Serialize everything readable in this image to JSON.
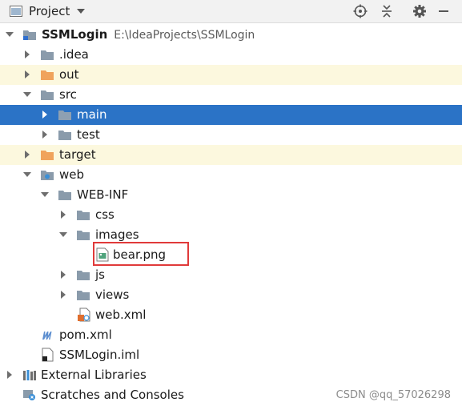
{
  "toolbar": {
    "title": "Project",
    "icons": [
      "project-pane-icon",
      "dropdown-icon",
      "locate-icon",
      "collapse-all-icon",
      "settings-gear-icon",
      "hide-minimize-icon"
    ]
  },
  "colors": {
    "selection": "#2b73c6",
    "excluded_row": "#fcf8de",
    "folder": "#8a9bab",
    "excluded_folder": "#f0a35c",
    "callout_border": "#e03a3a"
  },
  "tree": {
    "root": {
      "name": "SSMLogin",
      "path": "E:\\IdeaProjects\\SSMLogin"
    },
    "idea": ".idea",
    "out": "out",
    "src": "src",
    "main": "main",
    "test": "test",
    "target": "target",
    "web": "web",
    "webinf": "WEB-INF",
    "css": "css",
    "images": "images",
    "bear": "bear.png",
    "js": "js",
    "views": "views",
    "webxml": "web.xml",
    "pom": "pom.xml",
    "iml": "SSMLogin.iml",
    "extlib": "External Libraries",
    "scratches": "Scratches and Consoles"
  },
  "watermark": "CSDN @qq_57026298"
}
